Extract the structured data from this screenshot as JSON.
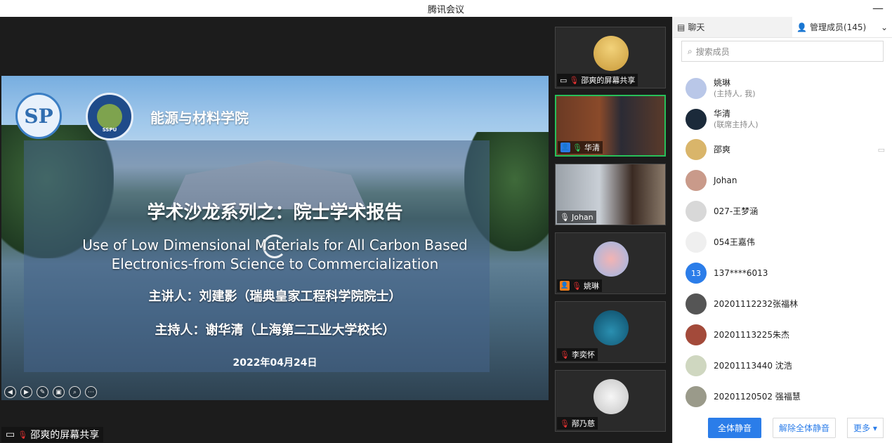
{
  "window": {
    "title": "腾讯会议",
    "minimize_glyph": "—"
  },
  "slide": {
    "school": "能源与材料学院",
    "logo1_text": "SP",
    "logo2_text": "SSPU",
    "title": "学术沙龙系列之：院士学术报告",
    "english_line1": "Use of Low Dimensional Materials for All Carbon Based",
    "english_line2": "Electronics-from Science to Commercialization",
    "speaker": "主讲人：刘建影（瑞典皇家工程科学院院士）",
    "host": "主持人：谢华清（上海第二工业大学校长）",
    "date": "2022年04月24日",
    "controls": [
      "◀",
      "▶",
      "✎",
      "▣",
      "⌕",
      "⋯"
    ]
  },
  "share_label": "邵爽的屏幕共享",
  "tiles": [
    {
      "name": "邵爽的屏幕共享",
      "icon": "screen-share-icon"
    },
    {
      "name": "华清",
      "icon": "user-icon"
    },
    {
      "name": "Johan",
      "icon": "mic-icon"
    },
    {
      "name": "姚琳",
      "icon": "user-icon"
    },
    {
      "name": "李奕怀",
      "icon": "mic-muted-icon"
    },
    {
      "name": "邴乃慈",
      "icon": "mic-muted-icon"
    }
  ],
  "sidebar": {
    "tab_chat": "聊天",
    "tab_members": "管理成员(145)",
    "search_placeholder": "搜索成员",
    "members": [
      {
        "name": "姚琳",
        "sub": "(主持人, 我)",
        "color": "#b9c7e8"
      },
      {
        "name": "华清",
        "sub": "(联席主持人)",
        "color": "#1b2a3a"
      },
      {
        "name": "邵爽",
        "sub": "",
        "color": "#d9b56a"
      },
      {
        "name": "Johan",
        "sub": "",
        "color": "#c99a8a"
      },
      {
        "name": "027-王梦涵",
        "sub": "",
        "color": "#d8d8d8"
      },
      {
        "name": "054王嘉伟",
        "sub": "",
        "color": "#efefef"
      },
      {
        "name": "137****6013",
        "sub": "",
        "color": "#2b7de9",
        "initial": "13"
      },
      {
        "name": "20201112232张福林",
        "sub": "",
        "color": "#555555"
      },
      {
        "name": "20201113225朱杰",
        "sub": "",
        "color": "#a34a3a"
      },
      {
        "name": "20201113440 沈浩",
        "sub": "",
        "color": "#cfd7c0"
      },
      {
        "name": "20201120502 强福慧",
        "sub": "",
        "color": "#9a9a8a"
      }
    ],
    "mute_all": "全体静音",
    "unmute_all": "解除全体静音",
    "more": "更多 ▾"
  }
}
